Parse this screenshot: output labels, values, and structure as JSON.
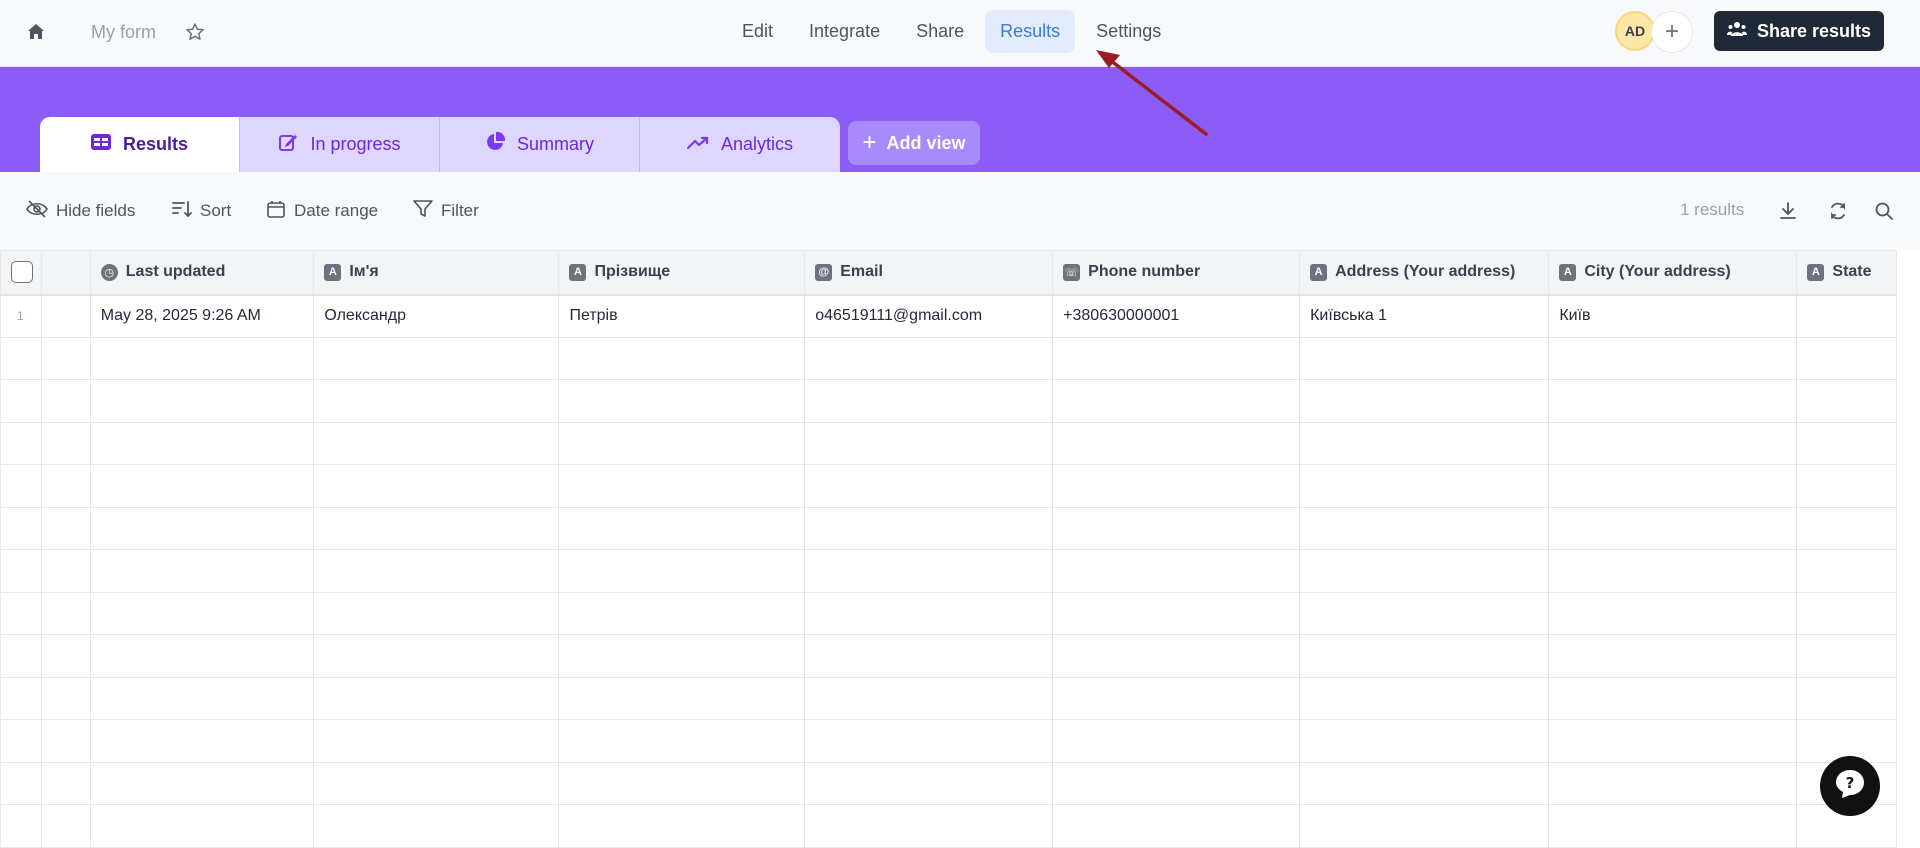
{
  "header": {
    "form_title": "My form",
    "nav": [
      {
        "label": "Edit"
      },
      {
        "label": "Integrate"
      },
      {
        "label": "Share"
      },
      {
        "label": "Results"
      },
      {
        "label": "Settings"
      }
    ],
    "avatar_initials": "AD",
    "share_results_label": "Share results"
  },
  "views": {
    "tabs": [
      {
        "label": "Results",
        "icon": "table-icon"
      },
      {
        "label": "In progress",
        "icon": "edit-icon"
      },
      {
        "label": "Summary",
        "icon": "pie-chart-icon"
      },
      {
        "label": "Analytics",
        "icon": "trend-icon"
      }
    ],
    "add_view_label": "Add view"
  },
  "toolbar": {
    "hide_fields": "Hide fields",
    "sort": "Sort",
    "date_range": "Date range",
    "filter": "Filter",
    "results_count": "1 results"
  },
  "table": {
    "columns": [
      {
        "label": "Last updated",
        "icon": "clock-icon"
      },
      {
        "label": "Ім'я",
        "icon": "text-icon"
      },
      {
        "label": "Прізвище",
        "icon": "text-icon"
      },
      {
        "label": "Email",
        "icon": "at-icon"
      },
      {
        "label": "Phone number",
        "icon": "phone-icon"
      },
      {
        "label": "Address (Your address)",
        "icon": "text-icon"
      },
      {
        "label": "City (Your address)",
        "icon": "text-icon"
      },
      {
        "label": "State",
        "icon": "text-icon"
      }
    ],
    "rows": [
      {
        "num": "1",
        "cells": [
          "May 28, 2025 9:26 AM",
          "Олександр",
          "Петрів",
          "o46519111@gmail.com",
          "+380630000001",
          "Київська 1",
          "Київ",
          ""
        ]
      }
    ]
  },
  "colors": {
    "banner": "#8b5cf6",
    "accent": "#3b7bd8",
    "arrow": "#9b1c24"
  }
}
